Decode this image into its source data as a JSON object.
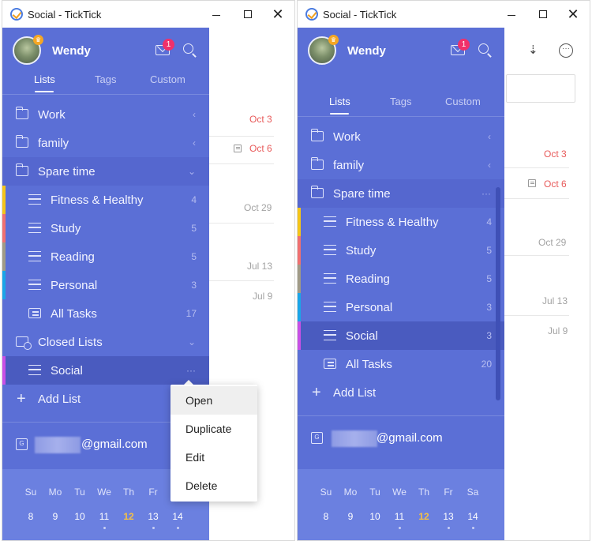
{
  "windows": [
    {
      "title": "Social - TickTick",
      "user": {
        "name": "Wendy",
        "mail_count": "1"
      },
      "tabs": [
        "Lists",
        "Tags",
        "Custom"
      ],
      "top_items": [
        {
          "label": "Work",
          "chevron": "‹"
        },
        {
          "label": "family",
          "chevron": "‹"
        },
        {
          "label": "Spare time",
          "chevron": "⌄"
        }
      ],
      "sub_items": [
        {
          "label": "Fitness & Healthy",
          "count": "4",
          "color": "#f5c518"
        },
        {
          "label": "Study",
          "count": "5",
          "color": "#f07070"
        },
        {
          "label": "Reading",
          "count": "5",
          "color": "#a09a86"
        },
        {
          "label": "Personal",
          "count": "3",
          "color": "#1aa5e8"
        },
        {
          "label": "All Tasks",
          "count": "17",
          "color": ""
        }
      ],
      "closed_lists": {
        "label": "Closed Lists",
        "chevron": "⌄"
      },
      "social": {
        "label": "Social",
        "more": "···",
        "color": "#c850e6"
      },
      "add_list": "Add List",
      "account_email": "@gmail.com",
      "calendar": {
        "days": [
          "Su",
          "Mo",
          "Tu",
          "We",
          "Th",
          "Fr",
          "Sa"
        ],
        "dates": [
          "8",
          "9",
          "10",
          "11",
          "12",
          "13",
          "14"
        ],
        "today_index": 4
      },
      "context_menu": [
        "Open",
        "Duplicate",
        "Edit",
        "Delete"
      ],
      "content_dates": [
        "Oct 3",
        "Oct 6",
        "Oct 29",
        "Jul 13",
        "Jul 9"
      ]
    },
    {
      "title": "Social - TickTick",
      "user": {
        "name": "Wendy",
        "mail_count": "1"
      },
      "tabs": [
        "Lists",
        "Tags",
        "Custom"
      ],
      "top_items": [
        {
          "label": "Work",
          "chevron": "‹"
        },
        {
          "label": "family",
          "chevron": "‹"
        },
        {
          "label": "Spare time",
          "chevron": "···"
        }
      ],
      "sub_items": [
        {
          "label": "Fitness & Healthy",
          "count": "4",
          "color": "#f5c518"
        },
        {
          "label": "Study",
          "count": "5",
          "color": "#f07070"
        },
        {
          "label": "Reading",
          "count": "5",
          "color": "#a09a86"
        },
        {
          "label": "Personal",
          "count": "3",
          "color": "#1aa5e8"
        },
        {
          "label": "Social",
          "count": "3",
          "color": "#c850e6"
        },
        {
          "label": "All Tasks",
          "count": "20",
          "color": ""
        }
      ],
      "add_list": "Add List",
      "account_email": "@gmail.com",
      "calendar": {
        "days": [
          "Su",
          "Mo",
          "Tu",
          "We",
          "Th",
          "Fr",
          "Sa"
        ],
        "dates": [
          "8",
          "9",
          "10",
          "11",
          "12",
          "13",
          "14"
        ],
        "today_index": 4
      },
      "content_dates": [
        "Oct 3",
        "Oct 6",
        "Oct 29",
        "Jul 13",
        "Jul 9"
      ]
    }
  ],
  "icons": {
    "app": "ticktick-logo-icon",
    "minimize": "minimize-icon",
    "maximize": "maximize-icon",
    "close": "close-icon",
    "mail": "mail-icon",
    "search": "search-icon",
    "folder": "folder-icon",
    "list": "list-icon",
    "all_tasks": "all-tasks-icon",
    "closed": "closed-lists-icon",
    "plus": "plus-icon",
    "calendar_account": "calendar-account-icon",
    "sort": "sort-icon",
    "more": "more-icon",
    "note": "note-icon"
  },
  "colors": {
    "sidebar": "#5b6fd6",
    "selected": "#4a5bbf",
    "today": "#f5c044",
    "badge": "#f0306a",
    "overdue": "#e85a5a"
  }
}
